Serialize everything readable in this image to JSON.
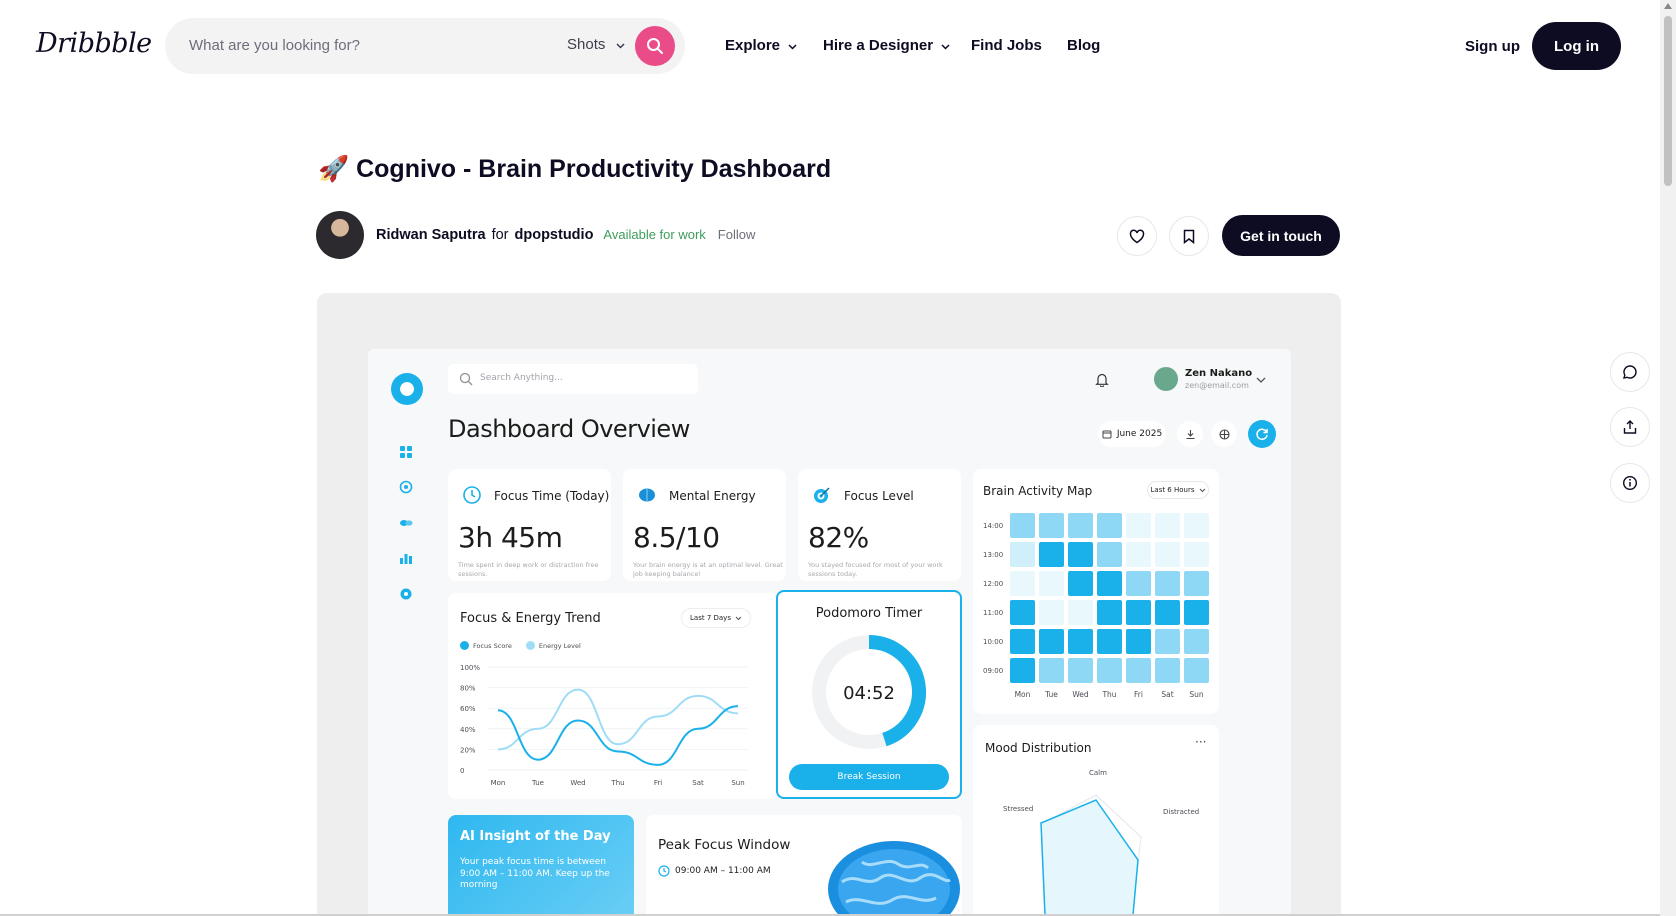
{
  "nav": {
    "logo": "Dribbble",
    "search_placeholder": "What are you looking for?",
    "search_scope": "Shots",
    "links": [
      "Explore",
      "Hire a Designer",
      "Find Jobs",
      "Blog"
    ],
    "signup": "Sign up",
    "login": "Log in"
  },
  "shot": {
    "emoji": "🚀",
    "title": "Cognivo - Brain Productivity Dashboard",
    "author": "Ridwan Saputra",
    "for_word": "for",
    "team": "dpopstudio",
    "availability": "Available for work",
    "follow": "Follow",
    "cta": "Get in touch"
  },
  "colors": {
    "brand_pink": "#ea4c89",
    "dark": "#0d0c22",
    "available_green": "#3f9d5b",
    "dash_blue": "#1ab0ea"
  },
  "dashboard": {
    "search_placeholder": "Search Anything...",
    "user_name": "Zen Nakano",
    "user_email": "zen@email.com",
    "heading": "Dashboard Overview",
    "month": "June 2025",
    "stats": [
      {
        "title": "Focus Time (Today)",
        "value": "3h 45m",
        "desc": "Time spent in deep work or distraction free sessions."
      },
      {
        "title": "Mental Energy",
        "value": "8.5/10",
        "desc": "Your brain energy is at an optimal level. Great job keeping balance!"
      },
      {
        "title": "Focus Level",
        "value": "82%",
        "desc": "You stayed focused for most of your work sessions today."
      }
    ],
    "brain_map": {
      "title": "Brain Activity Map",
      "range": "Last 6 Hours",
      "hours": [
        "14:00",
        "13:00",
        "12:00",
        "11:00",
        "10:00",
        "09:00"
      ],
      "days": [
        "Mon",
        "Tue",
        "Wed",
        "Thu",
        "Fri",
        "Sat",
        "Sun"
      ],
      "levels": [
        [
          2,
          2,
          2,
          2,
          0,
          0,
          0
        ],
        [
          1,
          3,
          3,
          2,
          0,
          0,
          0
        ],
        [
          0,
          0,
          3,
          3,
          2,
          2,
          2
        ],
        [
          3,
          0,
          0,
          3,
          3,
          3,
          3
        ],
        [
          3,
          3,
          3,
          3,
          3,
          2,
          2
        ],
        [
          3,
          2,
          2,
          2,
          2,
          2,
          2
        ]
      ]
    },
    "trend": {
      "title": "Focus & Energy Trend",
      "range": "Last 7 Days",
      "legend": [
        "Focus Score",
        "Energy Level"
      ],
      "yticks": [
        "100%",
        "80%",
        "60%",
        "40%",
        "20%",
        "0"
      ],
      "days": [
        "Mon",
        "Tue",
        "Wed",
        "Thu",
        "Fri",
        "Sat",
        "Sun"
      ],
      "focus": [
        58,
        10,
        48,
        18,
        5,
        40,
        62
      ],
      "energy": [
        20,
        40,
        78,
        25,
        52,
        72,
        55
      ]
    },
    "timer": {
      "title": "Podomoro Timer",
      "time": "04:52",
      "button": "Break Session",
      "progress": 0.45
    },
    "mood": {
      "title": "Mood Distribution",
      "labels": [
        "Calm",
        "Stressed",
        "Distracted"
      ]
    },
    "insight": {
      "title": "AI Insight of the Day",
      "text": "Your peak focus time is between 9:00 AM – 11:00 AM. Keep up the morning"
    },
    "peak": {
      "title": "Peak Focus Window",
      "time": "09:00 AM – 11:00 AM"
    }
  }
}
